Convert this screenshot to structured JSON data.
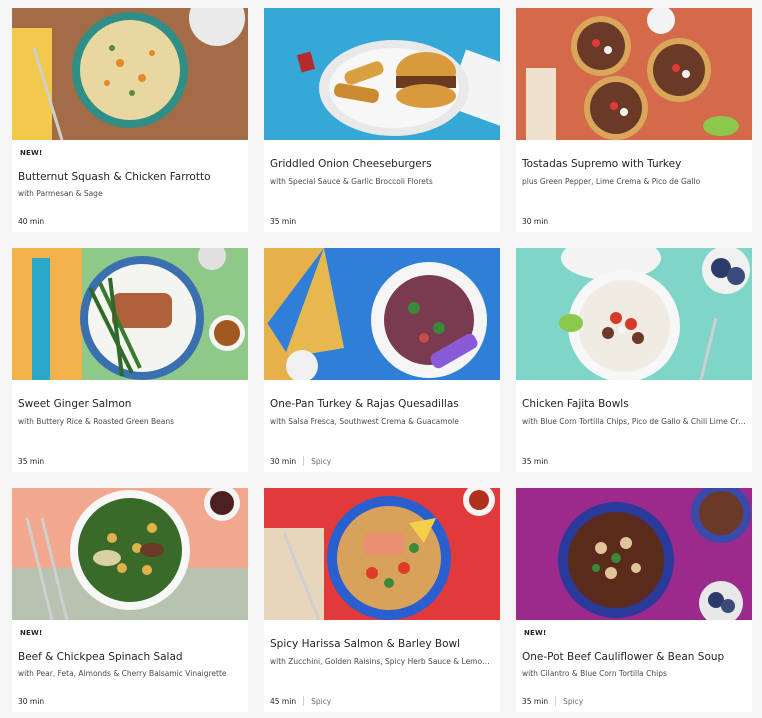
{
  "recipes": [
    {
      "badge": "NEW!",
      "title": "Butternut Squash & Chicken Farrotto",
      "subtitle": "with Parmesan & Sage",
      "time": "40 min",
      "tag": "",
      "bg": "#a8704a"
    },
    {
      "badge": "",
      "title": "Griddled Onion Cheeseburgers",
      "subtitle": "with Special Sauce & Garlic Broccoli Florets",
      "time": "35 min",
      "tag": "",
      "bg": "#35a8d8"
    },
    {
      "badge": "",
      "title": "Tostadas Supremo with Turkey",
      "subtitle": "plus Green Pepper, Lime Crema & Pico de Gallo",
      "time": "30 min",
      "tag": "",
      "bg": "#d46a4a"
    },
    {
      "badge": "",
      "title": "Sweet Ginger Salmon",
      "subtitle": "with Buttery Rice & Roasted Green Beans",
      "time": "35 min",
      "tag": "",
      "bg": "#8ec98a"
    },
    {
      "badge": "",
      "title": "One-Pan Turkey & Rajas Quesadillas",
      "subtitle": "with Salsa Fresca, Southwest Crema & Guacamole",
      "time": "30 min",
      "tag": "Spicy",
      "bg": "#2f7fd8"
    },
    {
      "badge": "",
      "title": "Chicken Fajita Bowls",
      "subtitle": "with Blue Corn Tortilla Chips, Pico de Gallo & Chili Lime Crema",
      "time": "35 min",
      "tag": "",
      "bg": "#7fd6c8"
    },
    {
      "badge": "NEW!",
      "title": "Beef & Chickpea Spinach Salad",
      "subtitle": "with Pear, Feta, Almonds & Cherry Balsamic Vinaigrette",
      "time": "30 min",
      "tag": "",
      "bg": "#f2a88e"
    },
    {
      "badge": "",
      "title": "Spicy Harissa Salmon & Barley Bowl",
      "subtitle": "with Zucchini, Golden Raisins, Spicy Herb Sauce & Lemon Crema",
      "time": "45 min",
      "tag": "Spicy",
      "bg": "#e23a3a"
    },
    {
      "badge": "NEW!",
      "title": "One-Pot Beef Cauliflower & Bean Soup",
      "subtitle": "with Cilantro & Blue Corn Tortilla Chips",
      "time": "35 min",
      "tag": "Spicy",
      "bg": "#9b2a8c"
    }
  ]
}
